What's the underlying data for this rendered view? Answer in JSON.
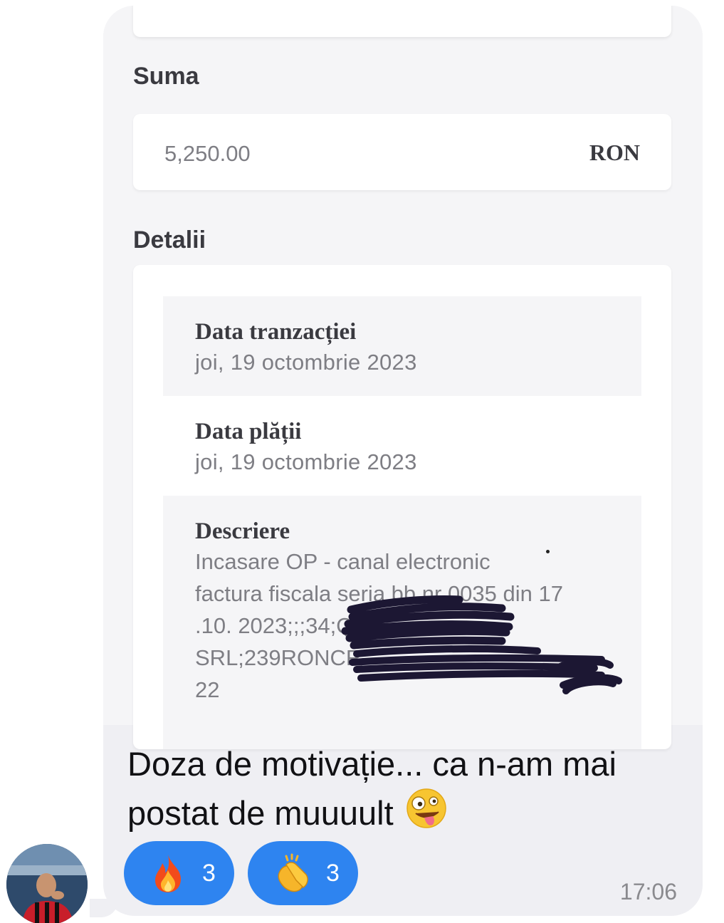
{
  "screenshot": {
    "amount_label": "Suma",
    "amount_value": "5,250.00",
    "amount_currency": "RON",
    "details_label": "Detalii",
    "details": [
      {
        "label": "Data tranzacției",
        "value": "joi, 19 octombrie 2023"
      },
      {
        "label": "Data plății",
        "value": "joi, 19 octombrie 2023"
      },
      {
        "label": "Descriere",
        "lines": [
          "Incasare OP - canal electronic",
          "factura fiscala seria bb nr 0035 din 17",
          ".10. 2023;;;34;QL",
          "SRL;239RONCR",
          "22"
        ]
      }
    ]
  },
  "message": {
    "text_line1": "Doza de motivație... ca n-am mai",
    "text_line2": "postat de muuuult",
    "text_emoji": "zany-face-emoji",
    "time": "17:06"
  },
  "reactions": [
    {
      "icon": "fire-emoji",
      "count": "3"
    },
    {
      "icon": "clapping-hands-emoji",
      "count": "3"
    }
  ],
  "colors": {
    "bubble": "#efeff3",
    "reaction": "#2e84f0",
    "redaction_ink": "#1c1733"
  }
}
